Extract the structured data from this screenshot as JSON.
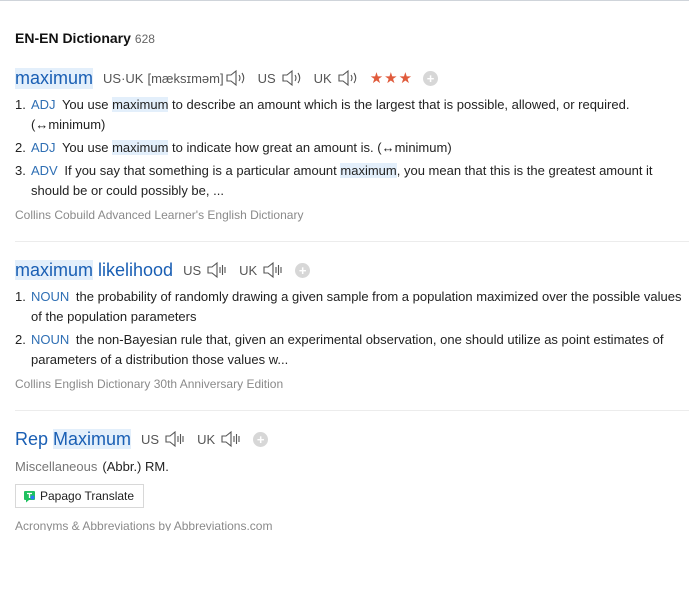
{
  "header": {
    "title": "EN-EN Dictionary",
    "count": "628"
  },
  "entries": [
    {
      "headword": "maximum",
      "pron_us_uk_label": "US·UK",
      "pron_ipa": "[mæksɪməm]",
      "us_label": "US",
      "uk_label": "UK",
      "stars": "★★★",
      "senses": [
        {
          "num": "1.",
          "pos": "ADJ",
          "pre": "You use ",
          "hl": "maximum",
          "post": " to describe an amount which is the largest that is possible, allowed, or required. (↔minimum)"
        },
        {
          "num": "2.",
          "pos": "ADJ",
          "pre": "You use ",
          "hl": "maximum",
          "post": " to indicate how great an amount is. (↔minimum)"
        },
        {
          "num": "3.",
          "pos": "ADV",
          "pre": "If you say that something is a particular amount ",
          "hl": "maximum",
          "post": ", you mean that this is the greatest amount it should be or could possibly be, ..."
        }
      ],
      "source": "Collins Cobuild Advanced Learner's English Dictionary"
    },
    {
      "headword_hl": "maximum",
      "headword_rest": " likelihood",
      "us_label": "US",
      "uk_label": "UK",
      "senses": [
        {
          "num": "1.",
          "pos": "NOUN",
          "text": "the probability of randomly drawing a given sample from a population maximized over the possible values of the population parameters"
        },
        {
          "num": "2.",
          "pos": "NOUN",
          "text": "the non-Bayesian rule that, given an experimental observation, one should utilize as point estimates of parameters of a distribution those values w..."
        }
      ],
      "source": "Collins English Dictionary 30th Anniversary Edition"
    },
    {
      "headword_pre": "Rep ",
      "headword_hl": "Maximum",
      "us_label": "US",
      "uk_label": "UK",
      "misc_label": "Miscellaneous",
      "misc_text": "(Abbr.) RM.",
      "papago_label": "Papago Translate",
      "source": "Acronyms & Abbreviations by Abbreviations.com"
    }
  ],
  "colors": {
    "headword": "#1a5fb4",
    "pos": "#2f6fb4",
    "highlight": "#e3effb",
    "stars": "#e05b3c"
  },
  "icons": {
    "speaker": "speaker-icon",
    "add": "plus-circle-icon",
    "papago": "papago-logo-icon"
  }
}
